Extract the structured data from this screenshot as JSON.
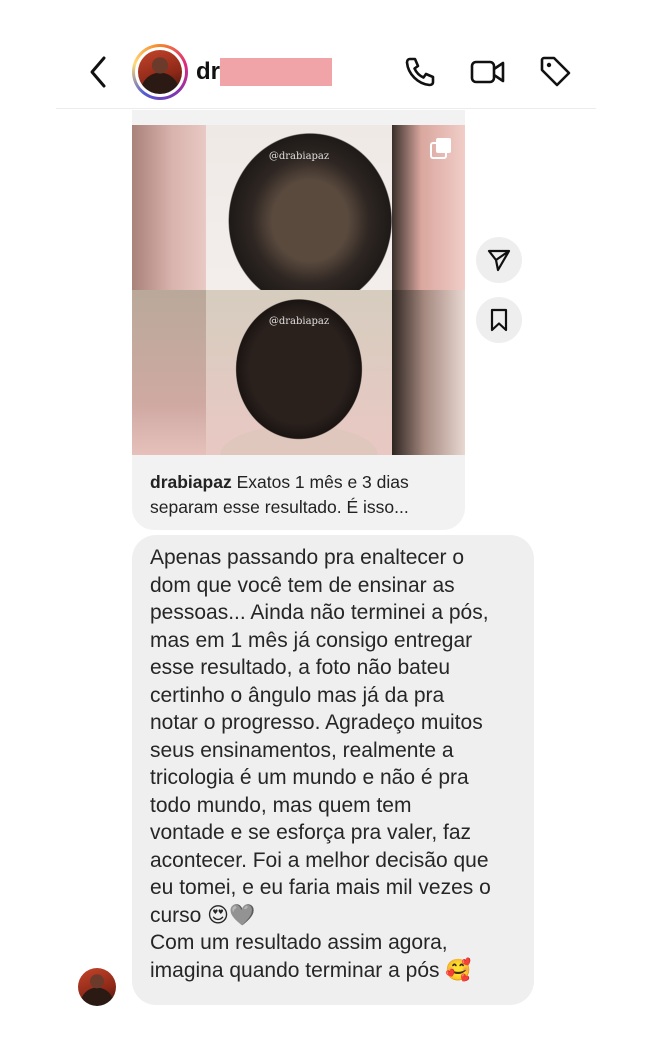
{
  "header": {
    "username_visible": "dr",
    "icons": [
      "back-icon",
      "phone-icon",
      "video-icon",
      "tag-icon"
    ]
  },
  "shared_post": {
    "watermark_top": "@drabiapaz",
    "watermark_bottom": "@drabiapaz",
    "caption_user": "drabiapaz",
    "caption_text_line1": " Exatos 1 mês e 3 dias",
    "caption_text_line2": "separam esse resultado. É isso..."
  },
  "side_actions": [
    "send-icon",
    "bookmark-icon"
  ],
  "message": {
    "lines": [
      "Apenas passando pra enaltecer o",
      "dom que você tem de ensinar as",
      "pessoas... Ainda não terminei a pós,",
      "mas em 1 mês já consigo entregar",
      "esse resultado, a foto não bateu",
      "certinho o ângulo mas já da pra",
      "notar o progresso. Agradeço muitos",
      "seus ensinamentos, realmente a",
      "tricologia é um mundo e não é pra",
      "todo mundo, mas quem tem",
      "vontade e se esforça pra valer, faz",
      "acontecer. Foi a melhor decisão que",
      "eu tomei, e eu faria mais mil vezes o",
      "curso 😍🩶",
      "Com um resultado assim agora,",
      "imagina quando terminar a pós 🥰"
    ]
  }
}
